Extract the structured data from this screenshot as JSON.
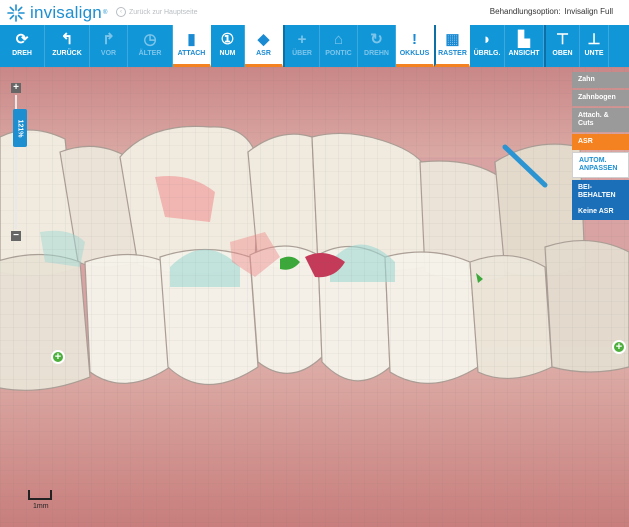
{
  "header": {
    "logo_text": "invisalign",
    "logo_registered": "®",
    "back_link": "Zurück zur Hauptseite",
    "treatment_label": "Behandlungsoption:",
    "treatment_value": "Invisalign Full"
  },
  "toolbar": {
    "buttons": [
      {
        "icon": "rotate-icon",
        "glyph": "⟳",
        "label": "DREH",
        "state": "normal"
      },
      {
        "icon": "undo-icon",
        "glyph": "↰",
        "label": "ZURÜCK",
        "state": "normal"
      },
      {
        "icon": "redo-icon",
        "glyph": "↱",
        "label": "VOR",
        "state": "disabled"
      },
      {
        "icon": "history-icon",
        "glyph": "◷",
        "label": "ÄLTER",
        "state": "disabled"
      },
      {
        "icon": "attachment-icon",
        "glyph": "▮",
        "label": "ATTACH",
        "state": "active"
      },
      {
        "icon": "number-icon",
        "glyph": "①",
        "label": "NUM",
        "state": "normal"
      },
      {
        "icon": "asr-icon",
        "glyph": "◆",
        "label": "ASR",
        "state": "active"
      },
      {
        "icon": "plus-icon",
        "glyph": "+",
        "label": "ÜBER",
        "state": "disabled"
      },
      {
        "icon": "pontic-icon",
        "glyph": "⌂",
        "label": "PONTIC",
        "state": "disabled"
      },
      {
        "icon": "rotation-icon",
        "glyph": "↻",
        "label": "DREHN",
        "state": "disabled"
      },
      {
        "icon": "occlusion-icon",
        "glyph": "!",
        "label": "OKKLUS",
        "state": "active"
      },
      {
        "icon": "grid-icon",
        "glyph": "▦",
        "label": "RASTER",
        "state": "active"
      },
      {
        "icon": "overlay-icon",
        "glyph": "◗",
        "label": "ÜBRLG.",
        "state": "normal"
      },
      {
        "icon": "view-icon",
        "glyph": "▙",
        "label": "ANSICHT",
        "state": "normal"
      },
      {
        "icon": "upper-icon",
        "glyph": "⊤",
        "label": "OBEN",
        "state": "normal"
      },
      {
        "icon": "lower-icon",
        "glyph": "⊥",
        "label": "UNTE",
        "state": "normal"
      }
    ]
  },
  "zoom": {
    "plus": "+",
    "minus": "−",
    "level": "121%",
    "level_fraction": 0.15
  },
  "right_panel": {
    "items": [
      {
        "label": "Zahn",
        "style": "gray"
      },
      {
        "label": "Zahnbogen",
        "style": "gray"
      },
      {
        "label": "Attach. & Cuts",
        "style": "gray"
      },
      {
        "label": "ASR",
        "style": "orange"
      },
      {
        "label": "AUTOM. ANPASSEN",
        "style": "white"
      },
      {
        "label": "BEI- BEHALTEN",
        "style": "blue"
      },
      {
        "label": "Keine ASR",
        "style": "blue"
      }
    ]
  },
  "add_buttons": [
    {
      "glyph": "+"
    },
    {
      "glyph": "+"
    }
  ],
  "scale": {
    "label": "1mm"
  },
  "colors": {
    "brand": "#1d8fd1",
    "toolbar": "#1196d8",
    "accent": "#f58220",
    "gum": "#d9a3a3",
    "tooth": "#f4f1e6",
    "add": "#4caf3c"
  }
}
